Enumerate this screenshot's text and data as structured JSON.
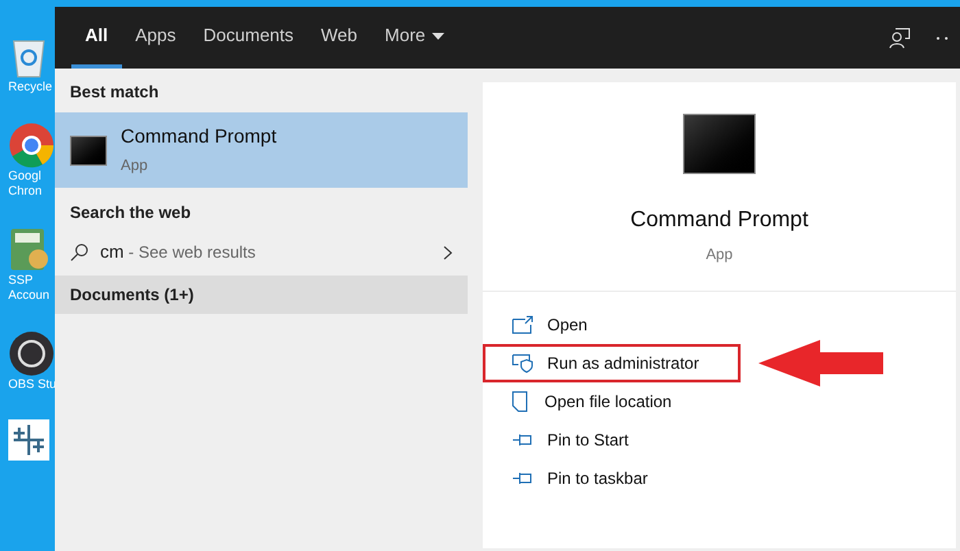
{
  "desktop_icons": [
    {
      "kind": "recycle",
      "lines": [
        "Recycle"
      ]
    },
    {
      "kind": "chrome",
      "lines": [
        "Googl",
        "Chron"
      ]
    },
    {
      "kind": "calc",
      "lines": [
        "SSP",
        "Accoun"
      ]
    },
    {
      "kind": "obs",
      "lines": [
        "OBS Stu"
      ]
    },
    {
      "kind": "grid"
    }
  ],
  "tabs": [
    {
      "label": "All",
      "selected": true
    },
    {
      "label": "Apps",
      "selected": false
    },
    {
      "label": "Documents",
      "selected": false
    },
    {
      "label": "Web",
      "selected": false
    },
    {
      "label": "More",
      "selected": false,
      "dropdown": true
    }
  ],
  "best_match": {
    "heading": "Best match",
    "title": "Command Prompt",
    "subtitle": "App",
    "selected": true
  },
  "web": {
    "heading": "Search the web",
    "query": "cm",
    "hint": " - See web results"
  },
  "documents": {
    "heading": "Documents (1+)"
  },
  "preview": {
    "title": "Command Prompt",
    "subtitle": "App"
  },
  "actions": [
    {
      "kind": "open",
      "label": "Open",
      "highlighted": false
    },
    {
      "kind": "shield",
      "label": "Run as administrator",
      "highlighted": true
    },
    {
      "kind": "folder",
      "label": "Open file location",
      "highlighted": false
    },
    {
      "kind": "pin",
      "label": "Pin to Start",
      "highlighted": false
    },
    {
      "kind": "pin",
      "label": "Pin to taskbar",
      "highlighted": false
    }
  ]
}
